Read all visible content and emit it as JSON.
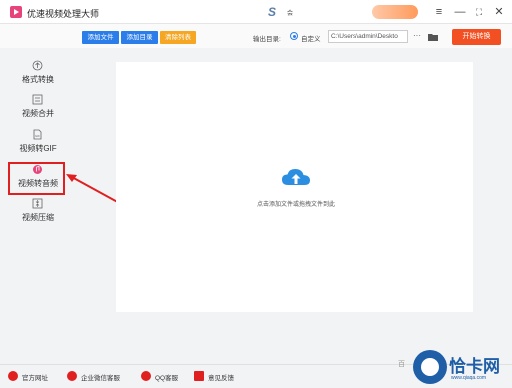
{
  "app": {
    "title": "优速视频处理大师",
    "brand_badge": "S",
    "brand_badge_label": "会"
  },
  "window_controls": {
    "menu": "≡",
    "minimize": "—",
    "maximize": "⛶",
    "close": "✕"
  },
  "toolbar": {
    "add_file": "添加文件",
    "add_dir": "添加目录",
    "clear_list": "清除列表",
    "output_label": "输出目录:",
    "custom_label": "自定义",
    "output_path": "C:\\Users\\admin\\Deskto",
    "more": "···",
    "start": "开始转换",
    "colors": {
      "add": "#2b7de9",
      "clear": "#f5a623",
      "start": "#f25022"
    }
  },
  "sidebar": {
    "items": [
      {
        "label": "格式转换",
        "icon": "format-convert-icon"
      },
      {
        "label": "视频合并",
        "icon": "video-merge-icon"
      },
      {
        "label": "视频转GIF",
        "icon": "gif-icon"
      },
      {
        "label": "视频转音频",
        "icon": "audio-icon",
        "active": true
      },
      {
        "label": "视频压缩",
        "icon": "compress-icon"
      }
    ]
  },
  "main": {
    "drop_hint": "点击添加文件或拖拽文件到此"
  },
  "footer": {
    "items": [
      {
        "label": "官方网址",
        "icon": "home-icon"
      },
      {
        "label": "企业微信客服",
        "icon": "wecom-icon"
      },
      {
        "label": "QQ客服",
        "icon": "qq-icon"
      },
      {
        "label": "意见反馈",
        "icon": "feedback-icon"
      }
    ]
  },
  "watermark": {
    "prefix": "百",
    "name": "恰卡网",
    "url": "www.qiaqa.com"
  }
}
